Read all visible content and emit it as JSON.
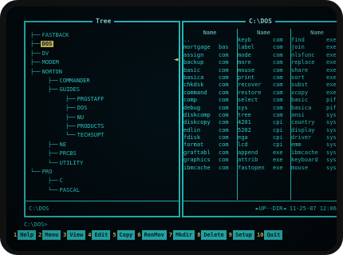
{
  "tree_pane": {
    "title": "Tree",
    "path": "C:\\DOS",
    "items": [
      {
        "label": "FASTBACK",
        "prefix": "├──",
        "indent": 0
      },
      {
        "label": "DOS",
        "prefix": "├──",
        "indent": 0,
        "selected": true
      },
      {
        "label": "DV",
        "prefix": "├──",
        "indent": 0
      },
      {
        "label": "MODEM",
        "prefix": "├──",
        "indent": 0
      },
      {
        "label": "NORTON",
        "prefix": "├──",
        "indent": 0
      },
      {
        "label": "COMMANDER",
        "prefix": "├──",
        "indent": 1
      },
      {
        "label": "GUIDES",
        "prefix": "├──",
        "indent": 1
      },
      {
        "label": "PRGSTAFF",
        "prefix": "├──",
        "indent": 2
      },
      {
        "label": "DOS",
        "prefix": "├──",
        "indent": 2
      },
      {
        "label": "NU",
        "prefix": "├──",
        "indent": 2
      },
      {
        "label": "PRODUCTS",
        "prefix": "├──",
        "indent": 2
      },
      {
        "label": "TECHSUPT",
        "prefix": "└──",
        "indent": 2
      },
      {
        "label": "NE",
        "prefix": "├──",
        "indent": 1
      },
      {
        "label": "PRCBS",
        "prefix": "├──",
        "indent": 1
      },
      {
        "label": "UTILITY",
        "prefix": "└──",
        "indent": 1
      },
      {
        "label": "PRO",
        "prefix": "└──",
        "indent": 0
      },
      {
        "label": "C",
        "prefix": "├──",
        "indent": 1
      },
      {
        "label": "PASCAL",
        "prefix": "└──",
        "indent": 1
      }
    ]
  },
  "list_pane": {
    "title": "C:\\DOS",
    "column_header": "Name",
    "status": "►UP--DIR◄ 11-25-87 12:06p",
    "columns": [
      [
        {
          "name": "..",
          "ext": ""
        },
        {
          "name": "mortgage",
          "ext": "bas"
        },
        {
          "name": "assign",
          "ext": "com"
        },
        {
          "name": "backup",
          "ext": "com"
        },
        {
          "name": "basic",
          "ext": "com"
        },
        {
          "name": "basica",
          "ext": "com"
        },
        {
          "name": "chkdsk",
          "ext": "com"
        },
        {
          "name": "command",
          "ext": "com"
        },
        {
          "name": "comp",
          "ext": "com"
        },
        {
          "name": "debug",
          "ext": "com"
        },
        {
          "name": "diskcomp",
          "ext": "com"
        },
        {
          "name": "diskcopy",
          "ext": "com"
        },
        {
          "name": "edlin",
          "ext": "com"
        },
        {
          "name": "fdisk",
          "ext": "com"
        },
        {
          "name": "format",
          "ext": "com"
        },
        {
          "name": "graftabl",
          "ext": "com"
        },
        {
          "name": "graphics",
          "ext": "com"
        },
        {
          "name": "ibmcache",
          "ext": "com"
        }
      ],
      [
        {
          "name": "keyb",
          "ext": "com"
        },
        {
          "name": "label",
          "ext": "com"
        },
        {
          "name": "mode",
          "ext": "com"
        },
        {
          "name": "more",
          "ext": "com"
        },
        {
          "name": "mouse",
          "ext": "com"
        },
        {
          "name": "print",
          "ext": "com"
        },
        {
          "name": "recover",
          "ext": "com"
        },
        {
          "name": "restore",
          "ext": "com"
        },
        {
          "name": "select",
          "ext": "com"
        },
        {
          "name": "sys",
          "ext": "com"
        },
        {
          "name": "tree",
          "ext": "com"
        },
        {
          "name": "4201",
          "ext": "cpi"
        },
        {
          "name": "5202",
          "ext": "cpi"
        },
        {
          "name": "ega",
          "ext": "cpi"
        },
        {
          "name": "lcd",
          "ext": "cpi"
        },
        {
          "name": "append",
          "ext": "exe"
        },
        {
          "name": "attrib",
          "ext": "exe"
        },
        {
          "name": "fastopen",
          "ext": "exe"
        }
      ],
      [
        {
          "name": "find",
          "ext": "exe"
        },
        {
          "name": "join",
          "ext": "exe"
        },
        {
          "name": "nlsfunc",
          "ext": "exe"
        },
        {
          "name": "replace",
          "ext": "exe"
        },
        {
          "name": "share",
          "ext": "exe"
        },
        {
          "name": "sort",
          "ext": "exe"
        },
        {
          "name": "subst",
          "ext": "exe"
        },
        {
          "name": "xcopy",
          "ext": "exe"
        },
        {
          "name": "basic",
          "ext": "pif"
        },
        {
          "name": "basica",
          "ext": "pif"
        },
        {
          "name": "ansi",
          "ext": "sys"
        },
        {
          "name": "country",
          "ext": "sys"
        },
        {
          "name": "display",
          "ext": "sys"
        },
        {
          "name": "driver",
          "ext": "sys"
        },
        {
          "name": "emm",
          "ext": "sys"
        },
        {
          "name": "ibmcache",
          "ext": "sys"
        },
        {
          "name": "keyboard",
          "ext": "sys"
        },
        {
          "name": "mouse",
          "ext": "sys"
        }
      ]
    ]
  },
  "prompt": "C:\\DOS>",
  "function_keys": [
    {
      "num": "1",
      "label": "Help"
    },
    {
      "num": "2",
      "label": "Menu"
    },
    {
      "num": "3",
      "label": "View"
    },
    {
      "num": "4",
      "label": "Edit"
    },
    {
      "num": "5",
      "label": "Copy"
    },
    {
      "num": "6",
      "label": "RenMov"
    },
    {
      "num": "7",
      "label": "Mkdir"
    },
    {
      "num": "8",
      "label": "Delete"
    },
    {
      "num": "9",
      "label": "Setup"
    },
    {
      "num": "10",
      "label": "Quit"
    }
  ],
  "colors": {
    "text": "#37e6e3",
    "selection_bg": "#ffe066",
    "fkey_bg": "#2ed6d3",
    "screen_bg": "#02080c"
  }
}
